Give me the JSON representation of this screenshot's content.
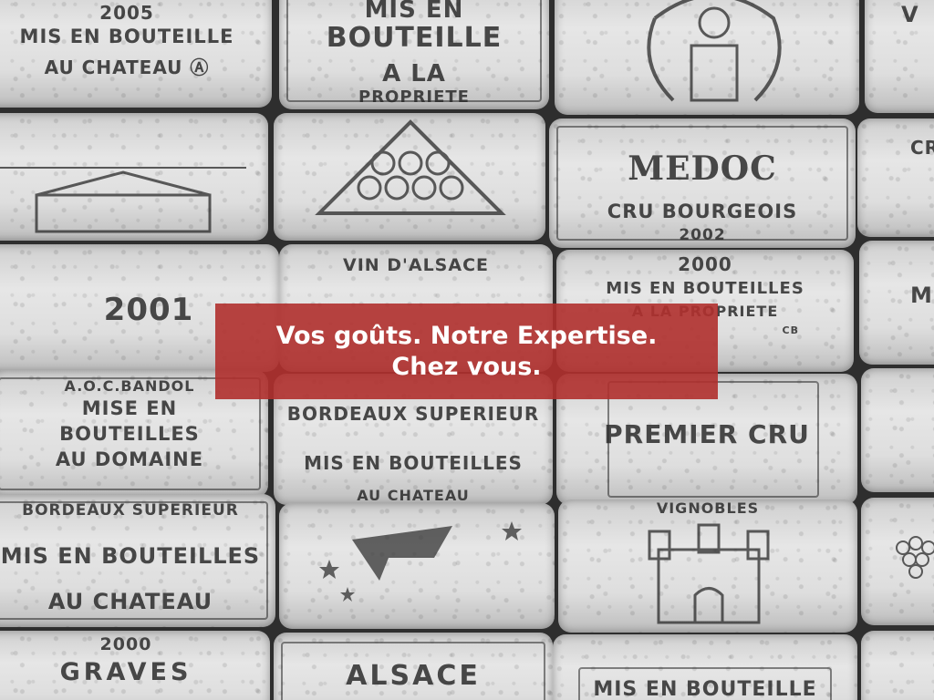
{
  "banner": {
    "line1": "Vos goûts. Notre Expertise.",
    "line2": "Chez vous.",
    "color": "#b0302d"
  },
  "corks": [
    {
      "id": "c1",
      "lines": [
        "2005",
        "MIS EN BOUTEILLE",
        "AU CHATEAU Ⓐ"
      ]
    },
    {
      "id": "c2",
      "lines": [
        "MIS EN",
        "BOUTEILLE",
        "A LA",
        "PROPRIETE"
      ]
    },
    {
      "id": "c3",
      "lines": [],
      "icon": "crest-icon"
    },
    {
      "id": "c4",
      "lines": [
        "V"
      ]
    },
    {
      "id": "c5",
      "lines": [],
      "icon": "chateau-icon"
    },
    {
      "id": "c6",
      "lines": [],
      "icon": "grapes-icon"
    },
    {
      "id": "c7",
      "lines": [
        "MEDOC",
        "CRU BOURGEOIS",
        "2002"
      ]
    },
    {
      "id": "c8",
      "lines": [
        "CR"
      ]
    },
    {
      "id": "c9",
      "lines": [
        "2001"
      ]
    },
    {
      "id": "c10",
      "lines": [
        "VIN D'ALSACE"
      ]
    },
    {
      "id": "c11",
      "lines": [
        "2000",
        "MIS EN BOUTEILLES",
        "A LA PROPRIETE",
        "CB"
      ]
    },
    {
      "id": "c12",
      "lines": [
        "MI"
      ]
    },
    {
      "id": "c13",
      "lines": [
        "A.O.C.BANDOL",
        "MISE EN",
        "BOUTEILLES",
        "AU DOMAINE"
      ]
    },
    {
      "id": "c14",
      "lines": [
        "BORDEAUX SUPERIEUR",
        "MIS EN BOUTEILLES",
        "AU CHATEAU"
      ]
    },
    {
      "id": "c15",
      "lines": [
        "PREMIER CRU"
      ]
    },
    {
      "id": "c16",
      "lines": []
    },
    {
      "id": "c17",
      "lines": [
        "BORDEAUX SUPERIEUR",
        "MIS EN BOUTEILLES",
        "AU CHATEAU"
      ]
    },
    {
      "id": "c18",
      "lines": [],
      "icon": "star-flag-icon"
    },
    {
      "id": "c19",
      "lines": [
        "VIGNOBLES"
      ],
      "icon": "castle-icon"
    },
    {
      "id": "c20",
      "lines": [],
      "icon": "grapes-icon"
    },
    {
      "id": "c21",
      "lines": [
        "2000",
        "GRAVES"
      ]
    },
    {
      "id": "c22",
      "lines": [
        "ALSACE"
      ]
    },
    {
      "id": "c23",
      "lines": [
        "MIS EN BOUTEILLE"
      ]
    },
    {
      "id": "c24",
      "lines": []
    }
  ]
}
